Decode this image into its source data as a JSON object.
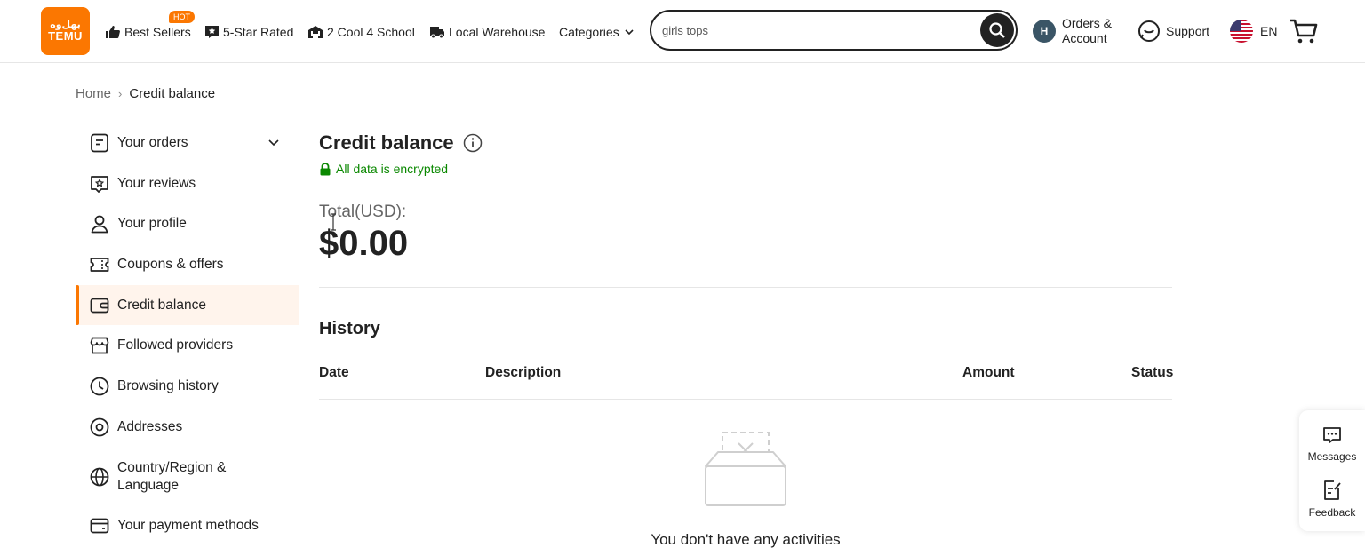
{
  "header": {
    "logo_line1": "ﺑﻬﻞﻭﻩ",
    "logo_line2": "TEMU",
    "nav": [
      {
        "label": "Best Sellers",
        "icon": "thumbs-up-icon"
      },
      {
        "label": "5-Star Rated",
        "icon": "star-rated-icon"
      },
      {
        "label": "2 Cool 4 School",
        "icon": "school-icon"
      },
      {
        "label": "Local Warehouse",
        "icon": "truck-icon"
      },
      {
        "label": "Categories",
        "icon": "chevron-down-icon"
      }
    ],
    "hot_badge": "HOT",
    "search": {
      "value": "girls tops"
    },
    "avatar_letter": "H",
    "orders_line1": "Orders &",
    "orders_line2": "Account",
    "support": "Support",
    "language": "EN"
  },
  "breadcrumb": {
    "home": "Home",
    "separator": "›",
    "current": "Credit balance"
  },
  "sidebar": {
    "items": [
      {
        "label": "Your orders",
        "icon": "orders-icon"
      },
      {
        "label": "Your reviews",
        "icon": "reviews-icon"
      },
      {
        "label": "Your profile",
        "icon": "profile-icon"
      },
      {
        "label": "Coupons & offers",
        "icon": "coupon-icon"
      },
      {
        "label": "Credit balance",
        "icon": "wallet-icon",
        "active": true
      },
      {
        "label": "Followed providers",
        "icon": "store-icon"
      },
      {
        "label": "Browsing history",
        "icon": "clock-icon"
      },
      {
        "label": "Addresses",
        "icon": "location-icon"
      },
      {
        "label": "Country/Region & Language",
        "icon": "globe-icon"
      },
      {
        "label": "Your payment methods",
        "icon": "card-icon"
      }
    ]
  },
  "main": {
    "title": "Credit balance",
    "encrypted": "All data is encrypted",
    "total_label": "Total(USD):",
    "total_value": "$0.00",
    "history_title": "History",
    "columns": [
      "Date",
      "Description",
      "Amount",
      "Status"
    ],
    "empty_text": "You don't have any activities"
  },
  "float": {
    "messages": "Messages",
    "feedback": "Feedback"
  },
  "colors": {
    "brand": "#fb7701",
    "secure": "#0a8800",
    "active_bg": "#fff4ec"
  }
}
